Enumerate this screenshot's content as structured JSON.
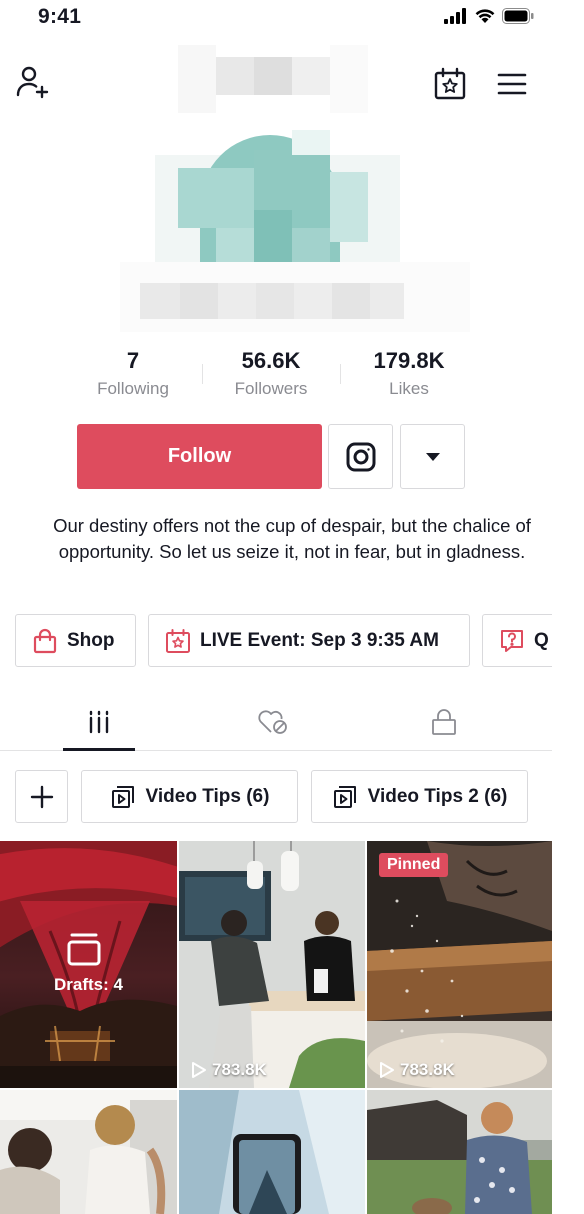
{
  "status_bar": {
    "time": "9:41"
  },
  "profile": {
    "stats": [
      {
        "value": "7",
        "label": "Following"
      },
      {
        "value": "56.6K",
        "label": "Followers"
      },
      {
        "value": "179.8K",
        "label": "Likes"
      }
    ],
    "follow_label": "Follow",
    "bio": "Our destiny offers not the cup of despair, but the chalice of opportunity. So let us seize it, not in fear, but in gladness."
  },
  "chips": [
    {
      "label": "Shop",
      "icon": "shopping-bag-icon"
    },
    {
      "label": "LIVE Event: Sep 3 9:35 AM",
      "icon": "calendar-star-icon"
    },
    {
      "label": "Q",
      "icon": "question-box-icon"
    }
  ],
  "tabs": [
    {
      "icon": "videos-grid-icon",
      "active": true
    },
    {
      "icon": "liked-hidden-icon",
      "active": false
    },
    {
      "icon": "lock-icon",
      "active": false
    }
  ],
  "playlists": [
    {
      "label": "Video Tips (6)"
    },
    {
      "label": "Video Tips 2 (6)"
    }
  ],
  "videos": [
    {
      "kind": "drafts",
      "label": "Drafts: 4"
    },
    {
      "kind": "video",
      "views": "783.8K"
    },
    {
      "kind": "video",
      "views": "783.8K",
      "badge": "Pinned"
    },
    {
      "kind": "video"
    },
    {
      "kind": "video"
    },
    {
      "kind": "video"
    }
  ],
  "colors": {
    "accent": "#de4c5e",
    "text": "#161823",
    "muted": "#8a8b91",
    "border": "#d9d9dc"
  }
}
